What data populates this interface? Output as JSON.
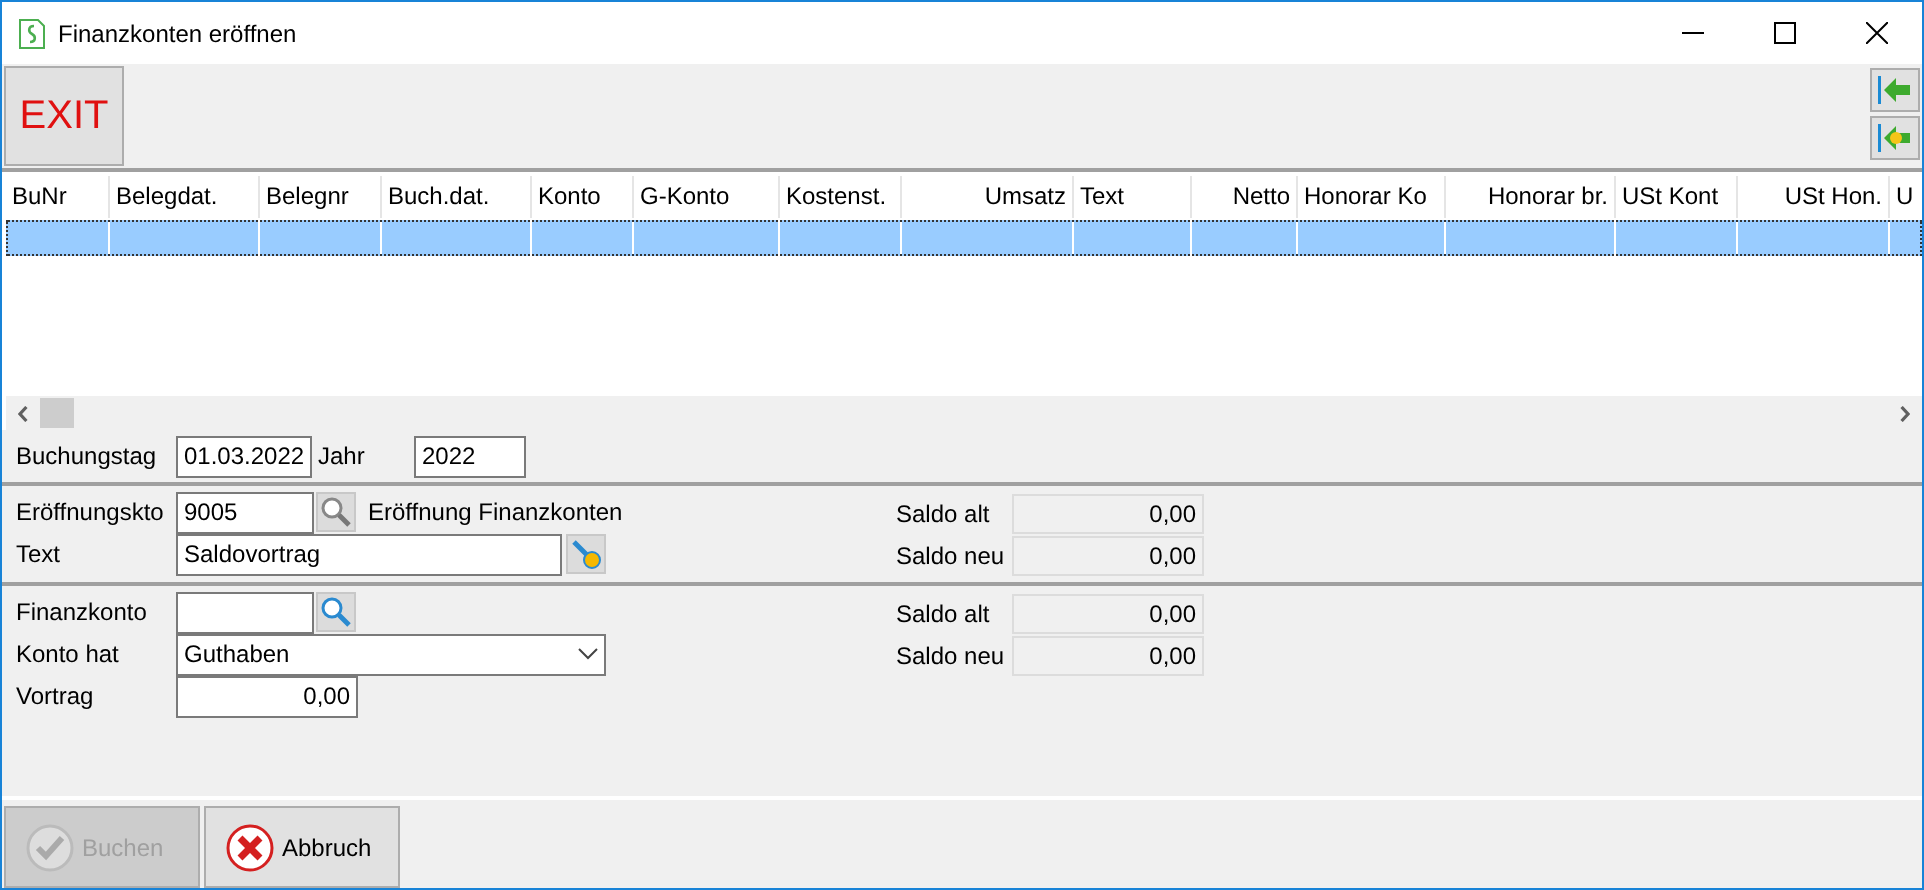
{
  "window": {
    "title": "Finanzkonten eröffnen"
  },
  "toolbar": {
    "exit": "EXIT"
  },
  "table": {
    "columns": [
      {
        "label": "BuNr",
        "right_aligned": false
      },
      {
        "label": "Belegdat.",
        "right_aligned": false
      },
      {
        "label": "Belegnr",
        "right_aligned": false
      },
      {
        "label": "Buch.dat.",
        "right_aligned": false
      },
      {
        "label": "Konto",
        "right_aligned": false
      },
      {
        "label": "G-Konto",
        "right_aligned": false
      },
      {
        "label": "Kostenst.",
        "right_aligned": false
      },
      {
        "label": "Umsatz",
        "right_aligned": true
      },
      {
        "label": "Text",
        "right_aligned": false
      },
      {
        "label": "Netto",
        "right_aligned": true
      },
      {
        "label": "Honorar Ko",
        "right_aligned": false
      },
      {
        "label": "Honorar br.",
        "right_aligned": true
      },
      {
        "label": "USt Kont",
        "right_aligned": false
      },
      {
        "label": "USt Hon.",
        "right_aligned": true
      },
      {
        "label": "U",
        "right_aligned": false
      }
    ],
    "rows": [
      {
        "selected": true
      }
    ]
  },
  "booking": {
    "date_label": "Buchungstag",
    "date": "01.03.2022",
    "year_label": "Jahr",
    "year": "2022"
  },
  "opening": {
    "account_label": "Eröffnungskto",
    "account": "9005",
    "account_name": "Eröffnung Finanzkonten",
    "text_label": "Text",
    "text": "Saldovortrag",
    "balances": [
      {
        "label": "Saldo alt",
        "value": "0,00"
      },
      {
        "label": "Saldo neu",
        "value": "0,00"
      }
    ]
  },
  "finance": {
    "account_label": "Finanzkonto",
    "has_label": "Konto hat",
    "has_value": "Guthaben",
    "carry_label": "Vortrag",
    "carry": "0,00",
    "balances": [
      {
        "label": "Saldo alt",
        "value": "0,00"
      },
      {
        "label": "Saldo neu",
        "value": "0,00"
      }
    ]
  },
  "buttons": [
    {
      "label": "Buchen",
      "kind": "ok",
      "disabled": true
    },
    {
      "label": "Abbruch",
      "kind": "cancel",
      "disabled": false
    }
  ]
}
